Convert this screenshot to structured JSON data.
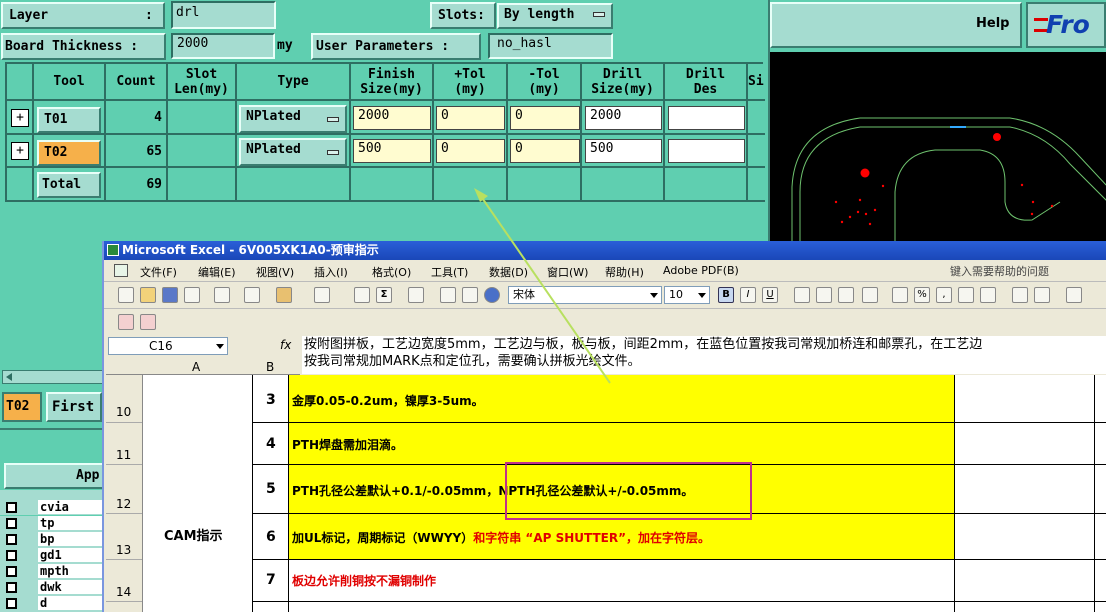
{
  "top": {
    "layer_label": "Layer",
    "layer_sep": ":",
    "layer_value": "drl",
    "slots_label": "Slots:",
    "slots_value": "By length",
    "board_label": "Board Thickness :",
    "board_value": "2000",
    "board_unit": "my",
    "user_params_label": "User Parameters :",
    "user_params_value": "no_hasl",
    "help_label": "Help",
    "logo_text": "Fro"
  },
  "table": {
    "headers": [
      "Tool",
      "Count",
      "Slot\nLen(my)",
      "Type",
      "Finish\nSize(my)",
      "+Tol\n(my)",
      "-Tol\n(my)",
      "Drill\nSize(my)",
      "Drill\nDes",
      "Si"
    ],
    "rows": [
      {
        "expander": "+",
        "tool": "T01",
        "count": "4",
        "type": "NPlated",
        "finish": "2000",
        "ptol": "0",
        "ntol": "0",
        "drill": "2000",
        "des": ""
      },
      {
        "expander": "+",
        "tool": "T02",
        "count": "65",
        "type": "NPlated",
        "finish": "500",
        "ptol": "0",
        "ntol": "0",
        "drill": "500",
        "des": ""
      }
    ],
    "total_label": "Total",
    "total_count": "69"
  },
  "left_bottom": {
    "tool_badge": "T02",
    "first_button": "First",
    "apply_button": "App",
    "layers": [
      "cvia",
      "tp",
      "bp",
      "gd1",
      "mpth",
      "dwk",
      "d"
    ]
  },
  "excel": {
    "title": "Microsoft Excel - 6V005XK1A0-预审指示",
    "menu": [
      "文件(F)",
      "编辑(E)",
      "视图(V)",
      "插入(I)",
      "格式(O)",
      "工具(T)",
      "数据(D)",
      "窗口(W)",
      "帮助(H)",
      "Adobe PDF(B)"
    ],
    "help_box": "键入需要帮助的问题",
    "font_name": "宋体",
    "font_size": "10",
    "cell_ref": "C16",
    "fx": "fx",
    "formula_line1": "按附图拼板，工艺边宽度5mm，工艺边与板，板与板，间距2mm，在蓝色位置按我司常规加桥连和邮票孔，在工艺边",
    "formula_line2": "按我司常规加MARK点和定位孔，需要确认拼板光绘文件。",
    "col_a": "A",
    "col_b": "B",
    "cam_label": "CAM指示",
    "rows": [
      {
        "rownum": "10",
        "num": "3",
        "text": "金厚0.05-0.2um，镍厚3-5um。"
      },
      {
        "rownum": "11",
        "num": "4",
        "text": "PTH焊盘需加泪滴。"
      },
      {
        "rownum": "12",
        "num": "5",
        "text": "PTH孔径公差默认+0.1/-0.05mm，NPTH孔径公差默认+/-0.05mm。"
      },
      {
        "rownum": "13",
        "num": "6",
        "text_a": "加UL标记，周期标记（WWYY）",
        "text_b": "和字符串 “AP SHUTTER”，加在字符层。"
      },
      {
        "rownum": "14",
        "num": "7",
        "text_b": "板边允许削铜按不漏铜制作"
      }
    ]
  },
  "colors": {
    "panel": "#5fcfb0",
    "excel_highlight": "#ffff00",
    "callout_box": "#c0308a",
    "red_text": "#e00000"
  }
}
